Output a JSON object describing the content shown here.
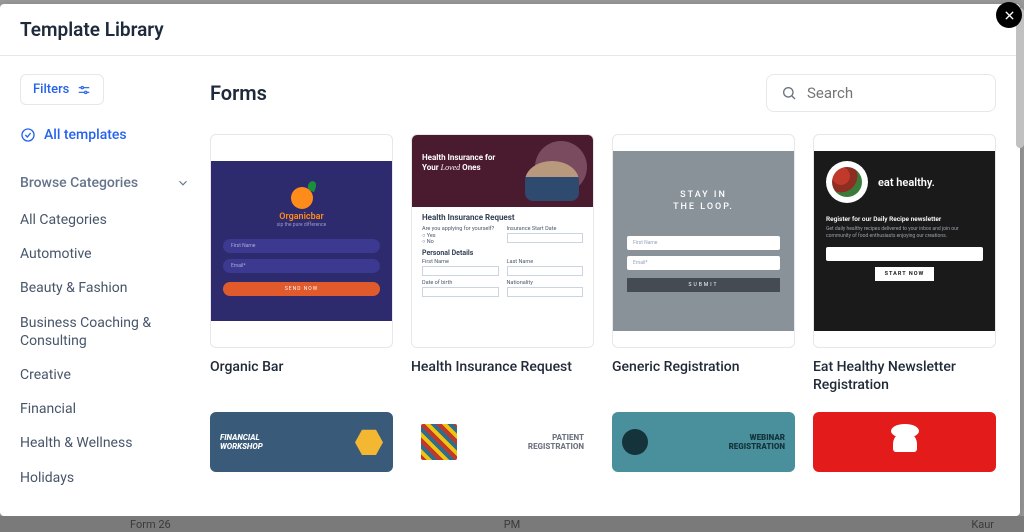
{
  "header": {
    "title": "Template Library"
  },
  "sidebar": {
    "filters_label": "Filters",
    "all_templates_label": "All templates",
    "browse_label": "Browse Categories",
    "categories": [
      "All Categories",
      "Automotive",
      "Beauty & Fashion",
      "Business Coaching & Consulting",
      "Creative",
      "Financial",
      "Health & Wellness",
      "Holidays"
    ]
  },
  "main": {
    "heading": "Forms",
    "search_placeholder": "Search"
  },
  "templates": [
    {
      "title": "Organic Bar"
    },
    {
      "title": "Health Insurance Request"
    },
    {
      "title": "Generic Registration"
    },
    {
      "title": "Eat Healthy Newsletter Registration"
    }
  ],
  "thumbs": {
    "organic": {
      "brand": "Organicbar",
      "tagline": "sip the pure difference",
      "f1": "First Name",
      "f2": "Email*",
      "submit": "SEND NOW"
    },
    "health": {
      "hero_line1": "Health Insurance for",
      "hero_line2_prefix": "Your ",
      "hero_line2_italic": "Loved",
      "hero_line2_suffix": " Ones",
      "req": "Health Insurance Request",
      "apply_q": "Are you applying for yourself?",
      "yes": "Yes",
      "no": "No",
      "start": "Insurance Start Date",
      "personal": "Personal Details",
      "fname": "First Name",
      "lname": "Last Name",
      "dob": "Date of birth",
      "nat": "Nationality"
    },
    "generic": {
      "stay": "STAY IN THE LOOP.",
      "f1": "First Name",
      "f2": "Email*",
      "submit": "SUBMIT"
    },
    "eat": {
      "title": "eat healthy.",
      "reg": "Register for our Daily Recipe newsletter",
      "desc": "Get daily healthy recipes delivered to your inbox and join our community of food enthusiasts enjoying our creations.",
      "btn": "START NOW"
    },
    "fin": "FINANCIAL WORKSHOP",
    "patient": "PATIENT REGISTRATION",
    "webinar": "WEBINAR REGISTRATION"
  },
  "footer": {
    "form_name": "Form 26",
    "pm": "PM",
    "user": "Kaur"
  }
}
